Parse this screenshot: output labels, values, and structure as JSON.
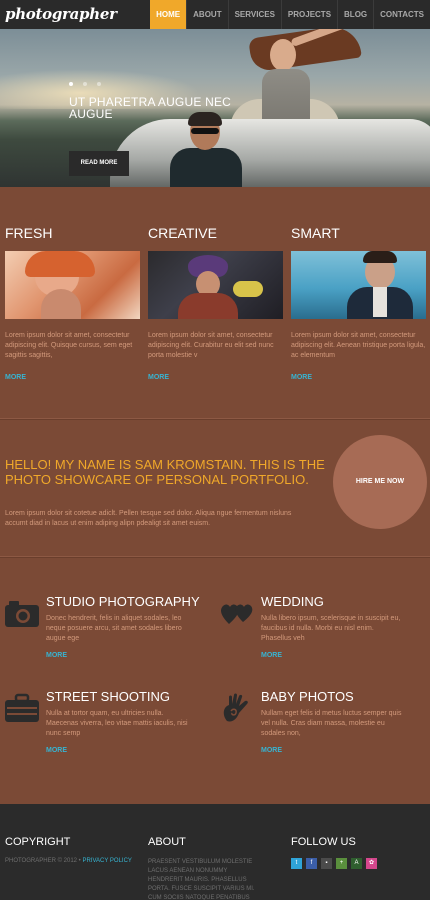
{
  "header": {
    "logo": "photographer",
    "nav": [
      "HOME",
      "ABOUT",
      "SERVICES",
      "PROJECTS",
      "BLOG",
      "CONTACTS"
    ]
  },
  "hero": {
    "title": "UT PHARETRA AUGUE NEC AUGUE",
    "button": "READ MORE",
    "slides": 3,
    "active_slide": 0
  },
  "features": [
    {
      "title": "FRESH",
      "text": "Lorem ipsum dolor sit amet, consectetur adipiscing elit. Quisque cursus, sem eget sagittis sagittis,",
      "more": "MORE"
    },
    {
      "title": "CREATIVE",
      "text": "Lorem ipsum dolor sit amet, consectetur adipiscing elit. Curabitur eu elit sed nunc porta molestie v",
      "more": "MORE"
    },
    {
      "title": "SMART",
      "text": "Lorem ipsum dolor sit amet, consectetur adipiscing elit. Aenean tristique porta ligula, ac elementum",
      "more": "MORE"
    }
  ],
  "intro": {
    "title": "HELLO! MY NAME IS SAM KROMSTAIN. THIS IS THE PHOTO SHOWCARE OF PERSONAL PORTFOLIO.",
    "text": "Lorem ipsum dolor sit cotetue adiclt. Pellen tesque sed dolor. Aliqua ngue fermentum nisluns accumt diad in lacus ut enim adiping alipn pdealigt sit amet euism.",
    "hire": "HIRE ME NOW"
  },
  "services": [
    {
      "title": "STUDIO PHOTOGRAPHY",
      "text": "Donec hendrerit, felis in aliquet sodales, leo neque posuere arcu, sit amet sodales libero augue ege",
      "more": "MORE",
      "icon": "camera-icon"
    },
    {
      "title": "WEDDING",
      "text": "Nulla libero ipsum, scelerisque in suscipit eu, faucibus id nulla. Morbi eu nisl enim. Phasellus veh",
      "more": "MORE",
      "icon": "hearts-icon"
    },
    {
      "title": "STREET SHOOTING",
      "text": "Nulla at tortor quam, eu ultricies nulla. Maecenas viverra, leo vitae mattis iaculis, nisi nunc semp",
      "more": "MORE",
      "icon": "briefcase-icon"
    },
    {
      "title": "BABY PHOTOS",
      "text": "Nullam eget felis id metus luctus semper quis vel nulla. Cras diam massa, molestie eu sodales non,",
      "more": "MORE",
      "icon": "hand-icon"
    }
  ],
  "footer": {
    "copyright_heading": "COPYRIGHT",
    "copyright_text": "PHOTOGRAPHER © 2012 •",
    "privacy": "PRIVACY POLICY",
    "about_heading": "ABOUT",
    "about_text": "PRAESENT VESTIBULUM MOLESTIE LACUS AENEAN NONUMMY HENDRERIT MAURIS. PHASELLUS PORTA. FUSCE SUSCIPIT VARIUS MI. CUM SOCIIS NATOQUE PENATIBUS ET",
    "follow_heading": "FOLLOW US",
    "socials": [
      {
        "name": "twitter-icon",
        "glyph": "t",
        "color": "#2fa4d8"
      },
      {
        "name": "facebook-icon",
        "glyph": "f",
        "color": "#3b5ea8"
      },
      {
        "name": "delicious-icon",
        "glyph": "▪",
        "color": "#4b4b4b"
      },
      {
        "name": "google-plus-icon",
        "glyph": "+",
        "color": "#5a8f3d"
      },
      {
        "name": "aim-icon",
        "glyph": "A",
        "color": "#2f5f2f"
      },
      {
        "name": "flickr-icon",
        "glyph": "✿",
        "color": "#d4478c"
      }
    ]
  }
}
